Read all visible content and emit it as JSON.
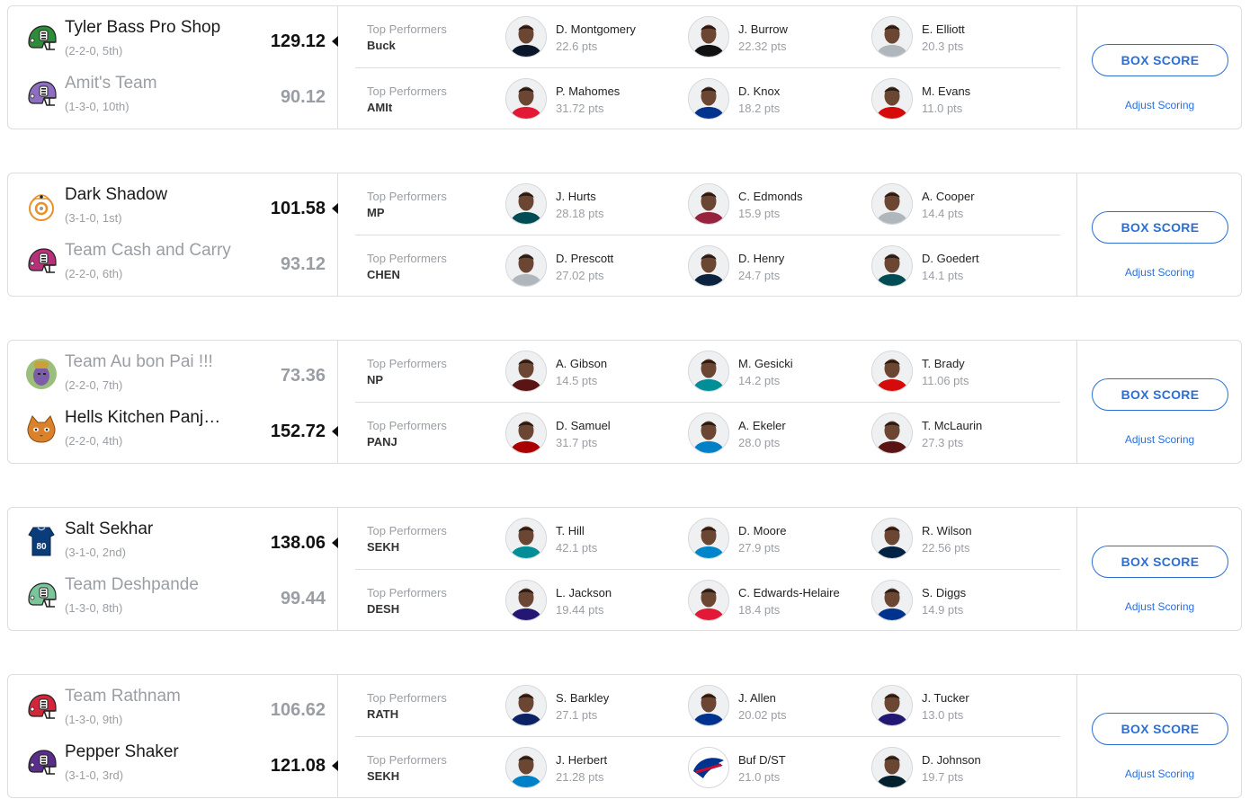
{
  "colors": {
    "accent": "#2b6fd6",
    "border": "#dcdddf",
    "muted": "#9a9ea4"
  },
  "matchups": [
    {
      "teams": [
        {
          "name": "Tyler Bass Pro Shop",
          "record": "(2-2-0, 5th)",
          "score": "129.12",
          "winner": true,
          "logo": "helmet-green-icon",
          "logo_color": "#2e8b3a"
        },
        {
          "name": "Amit's Team",
          "record": "(1-3-0, 10th)",
          "score": "90.12",
          "winner": false,
          "logo": "helmet-purple-icon",
          "logo_color": "#8d6ec0"
        }
      ],
      "performers": [
        {
          "label": "Top Performers",
          "abbr": "Buck",
          "players": [
            {
              "name": "D. Montgomery",
              "pts": "22.6 pts",
              "color": "#0b162a"
            },
            {
              "name": "J. Burrow",
              "pts": "22.32 pts",
              "color": "#111111"
            },
            {
              "name": "E. Elliott",
              "pts": "20.3 pts",
              "color": "#b0b7bc"
            }
          ]
        },
        {
          "label": "Top Performers",
          "abbr": "AMIt",
          "players": [
            {
              "name": "P. Mahomes",
              "pts": "31.72 pts",
              "color": "#e31837"
            },
            {
              "name": "D. Knox",
              "pts": "18.2 pts",
              "color": "#00338d"
            },
            {
              "name": "M. Evans",
              "pts": "11.0 pts",
              "color": "#d50a0a"
            }
          ]
        }
      ],
      "box_score": "BOX SCORE",
      "adjust": "Adjust Scoring"
    },
    {
      "teams": [
        {
          "name": "Dark Shadow",
          "record": "(3-1-0, 1st)",
          "score": "101.58",
          "winner": true,
          "logo": "bb8-droid-icon",
          "logo_color": "#e8902a"
        },
        {
          "name": "Team Cash and Carry",
          "record": "(2-2-0, 6th)",
          "score": "93.12",
          "winner": false,
          "logo": "helmet-magenta-icon",
          "logo_color": "#b8307a"
        }
      ],
      "performers": [
        {
          "label": "Top Performers",
          "abbr": "MP",
          "players": [
            {
              "name": "J. Hurts",
              "pts": "28.18 pts",
              "color": "#004c54"
            },
            {
              "name": "C. Edmonds",
              "pts": "15.9 pts",
              "color": "#97233f"
            },
            {
              "name": "A. Cooper",
              "pts": "14.4 pts",
              "color": "#b0b7bc"
            }
          ]
        },
        {
          "label": "Top Performers",
          "abbr": "CHEN",
          "players": [
            {
              "name": "D. Prescott",
              "pts": "27.02 pts",
              "color": "#b0b7bc"
            },
            {
              "name": "D. Henry",
              "pts": "24.7 pts",
              "color": "#0c2340"
            },
            {
              "name": "D. Goedert",
              "pts": "14.1 pts",
              "color": "#004c54"
            }
          ]
        }
      ],
      "box_score": "BOX SCORE",
      "adjust": "Adjust Scoring"
    },
    {
      "teams": [
        {
          "name": "Team Au bon Pai !!!",
          "record": "(2-2-0, 7th)",
          "score": "73.36",
          "winner": false,
          "logo": "thanos-avatar-icon",
          "logo_color": "#7b5ea7"
        },
        {
          "name": "Hells Kitchen Panjm...",
          "record": "(2-2-0, 4th)",
          "score": "152.72",
          "winner": true,
          "logo": "cat-avatar-icon",
          "logo_color": "#d9822b"
        }
      ],
      "performers": [
        {
          "label": "Top Performers",
          "abbr": "NP",
          "players": [
            {
              "name": "A. Gibson",
              "pts": "14.5 pts",
              "color": "#5a1414"
            },
            {
              "name": "M. Gesicki",
              "pts": "14.2 pts",
              "color": "#008e97"
            },
            {
              "name": "T. Brady",
              "pts": "11.06 pts",
              "color": "#d50a0a"
            }
          ]
        },
        {
          "label": "Top Performers",
          "abbr": "PANJ",
          "players": [
            {
              "name": "D. Samuel",
              "pts": "31.7 pts",
              "color": "#aa0000"
            },
            {
              "name": "A. Ekeler",
              "pts": "28.0 pts",
              "color": "#0080c6"
            },
            {
              "name": "T. McLaurin",
              "pts": "27.3 pts",
              "color": "#5a1414"
            }
          ]
        }
      ],
      "box_score": "BOX SCORE",
      "adjust": "Adjust Scoring"
    },
    {
      "teams": [
        {
          "name": "Salt Sekhar",
          "record": "(3-1-0, 2nd)",
          "score": "138.06",
          "winner": true,
          "logo": "jersey-80-icon",
          "logo_color": "#0b3c7a"
        },
        {
          "name": "Team Deshpande",
          "record": "(1-3-0, 8th)",
          "score": "99.44",
          "winner": false,
          "logo": "helmet-mint-icon",
          "logo_color": "#7cc49a"
        }
      ],
      "performers": [
        {
          "label": "Top Performers",
          "abbr": "SEKH",
          "players": [
            {
              "name": "T. Hill",
              "pts": "42.1 pts",
              "color": "#008e97"
            },
            {
              "name": "D. Moore",
              "pts": "27.9 pts",
              "color": "#0085ca"
            },
            {
              "name": "R. Wilson",
              "pts": "22.56 pts",
              "color": "#002244"
            }
          ]
        },
        {
          "label": "Top Performers",
          "abbr": "DESH",
          "players": [
            {
              "name": "L. Jackson",
              "pts": "19.44 pts",
              "color": "#241773"
            },
            {
              "name": "C. Edwards-Helaire",
              "pts": "18.4 pts",
              "color": "#e31837"
            },
            {
              "name": "S. Diggs",
              "pts": "14.9 pts",
              "color": "#00338d"
            }
          ]
        }
      ],
      "box_score": "BOX SCORE",
      "adjust": "Adjust Scoring"
    },
    {
      "teams": [
        {
          "name": "Team Rathnam",
          "record": "(1-3-0, 9th)",
          "score": "106.62",
          "winner": false,
          "logo": "helmet-red-icon",
          "logo_color": "#d2263a"
        },
        {
          "name": "Pepper Shaker",
          "record": "(3-1-0, 3rd)",
          "score": "121.08",
          "winner": true,
          "logo": "helmet-violet-icon",
          "logo_color": "#5a2d8c"
        }
      ],
      "performers": [
        {
          "label": "Top Performers",
          "abbr": "RATH",
          "players": [
            {
              "name": "S. Barkley",
              "pts": "27.1 pts",
              "color": "#0b2265"
            },
            {
              "name": "J. Allen",
              "pts": "20.02 pts",
              "color": "#00338d"
            },
            {
              "name": "J. Tucker",
              "pts": "13.0 pts",
              "color": "#241773"
            }
          ]
        },
        {
          "label": "Top Performers",
          "abbr": "SEKH",
          "players": [
            {
              "name": "J. Herbert",
              "pts": "21.28 pts",
              "color": "#0080c6"
            },
            {
              "name": "Buf D/ST",
              "pts": "21.0 pts",
              "color": "#00338d",
              "is_logo": true
            },
            {
              "name": "D. Johnson",
              "pts": "19.7 pts",
              "color": "#03202f"
            }
          ]
        }
      ],
      "box_score": "BOX SCORE",
      "adjust": "Adjust Scoring"
    }
  ]
}
